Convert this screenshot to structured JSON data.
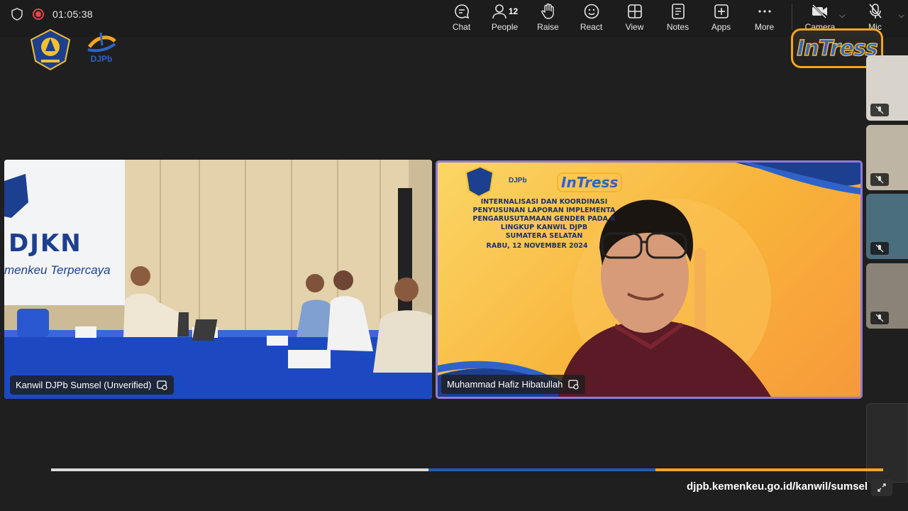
{
  "header": {
    "timer": "01:05:38",
    "tools": [
      {
        "label": "Chat",
        "icon": "chat-icon"
      },
      {
        "label": "People",
        "icon": "people-icon",
        "count": "12"
      },
      {
        "label": "Raise",
        "icon": "raise-hand-icon"
      },
      {
        "label": "React",
        "icon": "react-icon"
      },
      {
        "label": "View",
        "icon": "view-icon"
      },
      {
        "label": "Notes",
        "icon": "notes-icon"
      },
      {
        "label": "Apps",
        "icon": "apps-icon"
      },
      {
        "label": "More",
        "icon": "more-icon"
      }
    ],
    "camera_label": "Camera",
    "mic_label": "Mic"
  },
  "branding": {
    "left_logo_text": "DJPb",
    "right_logo_text": "InTress"
  },
  "tiles": [
    {
      "name": "Kanwil DJPb Sumsel (Unverified)",
      "wall_text_1": "DJKN",
      "wall_text_2": "menkeu Terpercaya"
    },
    {
      "name": "Muhammad Hafiz Hibatullah",
      "banner_lines": [
        "INTERNALISASI DAN KOORDINASI",
        "PENYUSUNAN LAPORAN IMPLEMENTA",
        "PENGARUSUTAMAAN GENDER PADA K",
        "LINGKUP KANWIL DJPB",
        "SUMATERA SELATAN"
      ],
      "banner_date": "RABU, 12 NOVEMBER 2024",
      "banner_logo_1": "DJPb",
      "banner_logo_2": "InTress"
    }
  ],
  "footer": {
    "url": "djpb.kemenkeu.go.id/kanwil/sumsel"
  },
  "colors": {
    "accent_border": "#8f7ad8",
    "record": "#e04848",
    "progress_white": "#d9d9d9",
    "progress_blue": "#1f5fae",
    "progress_gold": "#f0a62a"
  }
}
